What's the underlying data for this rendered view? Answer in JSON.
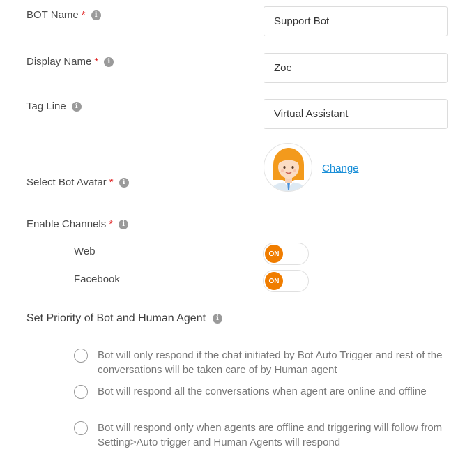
{
  "bot_name": {
    "label": "BOT Name",
    "required_mark": "*",
    "value": "Support Bot"
  },
  "display_name": {
    "label": "Display Name",
    "required_mark": "*",
    "value": "Zoe"
  },
  "tag_line": {
    "label": "Tag Line",
    "value": "Virtual Assistant"
  },
  "avatar": {
    "label": "Select Bot Avatar",
    "required_mark": "*",
    "change_label": "Change"
  },
  "channels": {
    "label": "Enable Channels",
    "required_mark": "*",
    "items": [
      {
        "label": "Web",
        "toggle_text": "ON",
        "enabled": true
      },
      {
        "label": "Facebook",
        "toggle_text": "ON",
        "enabled": true
      }
    ]
  },
  "priority": {
    "title": "Set Priority of Bot and Human Agent",
    "options": [
      {
        "text": "Bot will only respond if the chat initiated by Bot Auto Trigger and rest of the conversations will be taken care of by Human agent",
        "selected": false
      },
      {
        "text": "Bot will respond all the conversations when agent are online and offline",
        "selected": false
      },
      {
        "text": "Bot will respond only when agents are offline and triggering will follow from Setting>Auto trigger and Human Agents will respond",
        "selected": false
      }
    ]
  },
  "info_icon": "i",
  "colors": {
    "accent": "#f07d00",
    "link": "#1a8fd8",
    "required": "#e02020"
  }
}
